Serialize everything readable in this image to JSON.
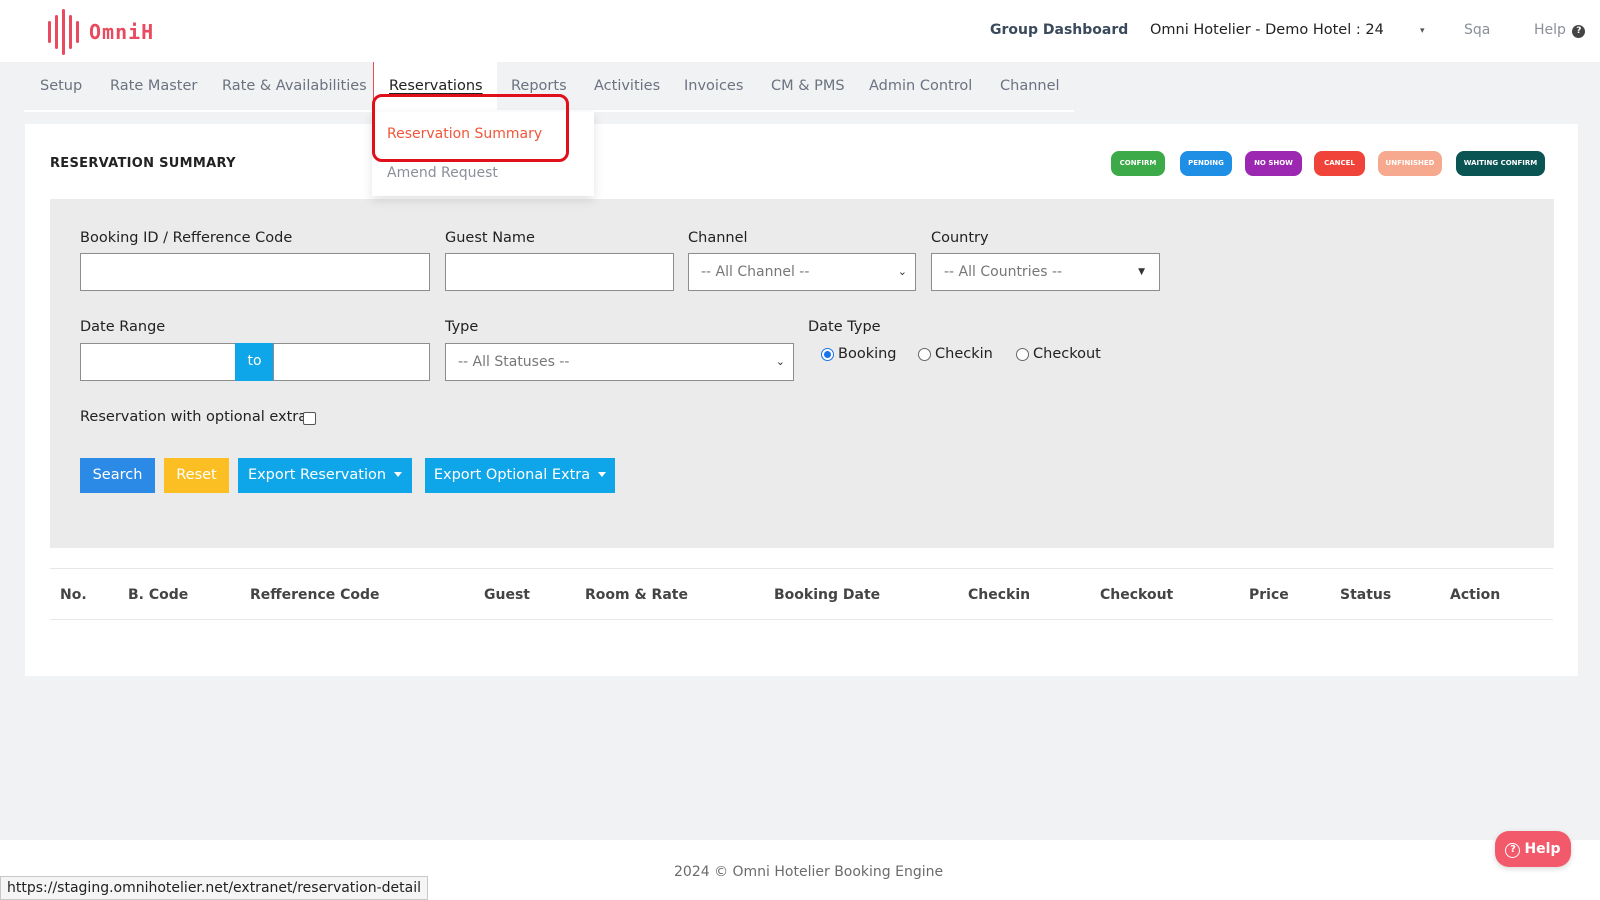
{
  "header": {
    "logo_text": "OmniH",
    "group_dashboard": "Group Dashboard",
    "hotel_selector": "Omni Hotelier - Demo Hotel : 24",
    "hotel_caret": "▾",
    "user": "Sqa",
    "help": "Help",
    "help_icon": "?"
  },
  "nav": {
    "items": [
      "Setup",
      "Rate Master",
      "Rate & Availabilities",
      "Reservations",
      "Reports",
      "Activities",
      "Invoices",
      "CM & PMS",
      "Admin Control",
      "Channel"
    ],
    "active": "Reservations"
  },
  "dropdown": {
    "items": [
      "Reservation Summary",
      "Amend Request"
    ],
    "active_color": "#f0563a"
  },
  "page": {
    "title": "RESERVATION SUMMARY",
    "legend": [
      {
        "label": "CONFIRM",
        "color": "#3caa48"
      },
      {
        "label": "PENDING",
        "color": "#1e8fe5"
      },
      {
        "label": "NO SHOW",
        "color": "#9c27b0"
      },
      {
        "label": "CANCEL",
        "color": "#f0433a"
      },
      {
        "label": "UNFINISHED",
        "color": "#f6a98e"
      },
      {
        "label": "WAITING CONFIRM",
        "color": "#0b5454"
      }
    ]
  },
  "filters": {
    "booking_id_label": "Booking ID / Refference Code",
    "booking_id_value": "",
    "guest_name_label": "Guest Name",
    "guest_name_value": "",
    "channel_label": "Channel",
    "channel_value": "-- All Channel --",
    "country_label": "Country",
    "country_value": "-- All Countries --",
    "date_range_label": "Date Range",
    "date_from": "",
    "date_to_label": "to",
    "date_to": "",
    "type_label": "Type",
    "type_value": "-- All Statuses --",
    "date_type_label": "Date Type",
    "date_type_options": [
      "Booking",
      "Checkin",
      "Checkout"
    ],
    "date_type_selected": "Booking",
    "optional_extra_label": "Reservation with optional extra",
    "optional_extra_checked": false
  },
  "buttons": {
    "search": "Search",
    "reset": "Reset",
    "export_reservation": "Export Reservation",
    "export_optional_extra": "Export Optional Extra"
  },
  "table": {
    "columns": [
      "No.",
      "B. Code",
      "Refference Code",
      "Guest",
      "Room & Rate",
      "Booking Date",
      "Checkin",
      "Checkout",
      "Price",
      "Status",
      "Action"
    ],
    "rows": []
  },
  "footer": {
    "copyright": "2024 © Omni Hotelier Booking Engine",
    "help_button": "Help",
    "status_url": "https://staging.omnihotelier.net/extranet/reservation-detail"
  }
}
